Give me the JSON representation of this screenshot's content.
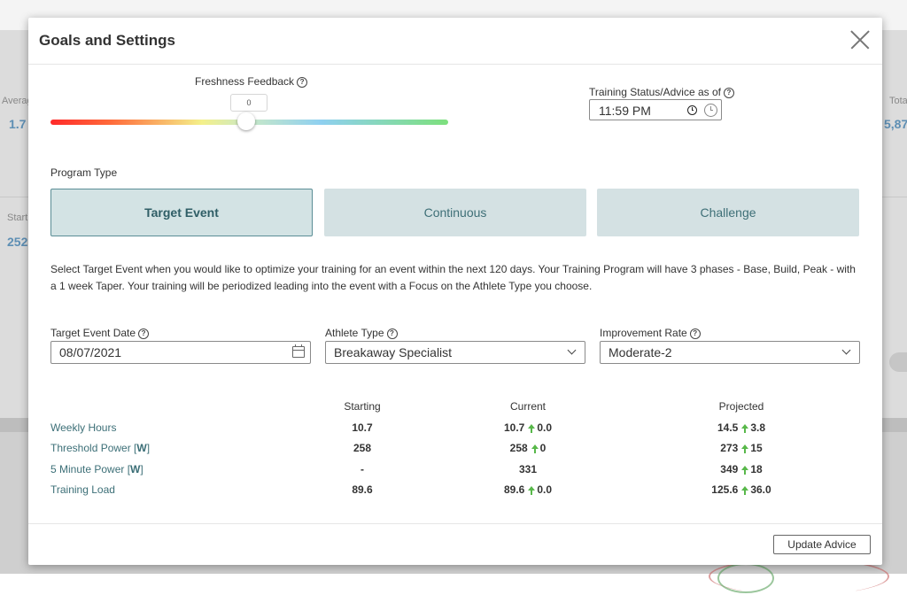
{
  "background": {
    "labels": [
      "Averag",
      "Start",
      "Tota"
    ],
    "numbers": [
      "1.7",
      "252",
      "5,87"
    ]
  },
  "modal": {
    "title": "Goals and Settings"
  },
  "freshness": {
    "label": "Freshness Feedback",
    "value": "0"
  },
  "status": {
    "label": "Training Status/Advice as of",
    "time": "11:59 PM"
  },
  "program": {
    "label": "Program Type",
    "options": [
      "Target Event",
      "Continuous",
      "Challenge"
    ],
    "selected": "Target Event",
    "description": "Select Target Event when you would like to optimize your training for an event within the next 120 days. Your Training Program will have 3 phases - Base, Build, Peak - with a 1 week Taper. Your training will be periodized leading into the event with a Focus on the Athlete Type you choose."
  },
  "fields": {
    "event_date_label": "Target Event Date",
    "event_date": "08/07/2021",
    "athlete_type_label": "Athlete Type",
    "athlete_type": "Breakaway Specialist",
    "improvement_label": "Improvement Rate",
    "improvement": "Moderate-2"
  },
  "table": {
    "headers": [
      "Starting",
      "Current",
      "Projected"
    ],
    "rows": [
      {
        "label": "Weekly Hours",
        "unit": "",
        "starting": "10.7",
        "current": "10.7",
        "current_delta": "0.0",
        "projected": "14.5",
        "projected_delta": "3.8"
      },
      {
        "label": "Threshold Power",
        "unit": "W",
        "starting": "258",
        "current": "258",
        "current_delta": "0",
        "projected": "273",
        "projected_delta": "15"
      },
      {
        "label": "5 Minute Power",
        "unit": "W",
        "starting": "-",
        "current": "331",
        "current_delta": "",
        "projected": "349",
        "projected_delta": "18"
      },
      {
        "label": "Training Load",
        "unit": "",
        "starting": "89.6",
        "current": "89.6",
        "current_delta": "0.0",
        "projected": "125.6",
        "projected_delta": "36.0"
      }
    ]
  },
  "footer": {
    "update_label": "Update Advice"
  },
  "colors": {
    "accent": "#3e6f77",
    "button_bg": "#d4e1e3",
    "up_arrow": "#58b84a"
  }
}
